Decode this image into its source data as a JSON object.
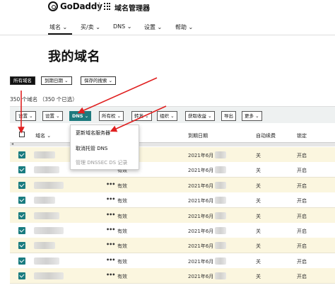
{
  "header": {
    "logo_text": "GoDaddy",
    "app_title": "域名管理器"
  },
  "nav": {
    "items": [
      "域名 ⌄",
      "买/卖 ⌄",
      "DNS ⌄",
      "设置 ⌄",
      "帮助 ⌄"
    ]
  },
  "page_title": "我的域名",
  "filters": [
    "所有域名",
    "到期日期 ⌄",
    "保存的搜索 ⌄"
  ],
  "count_text": "350 个域名 （350 个已选）",
  "toolbar": [
    "设置 ⌄",
    "设置 ⌄",
    "DNS ⌄",
    "所有权 ⌄",
    "转发 ⌄",
    "组织 ⌄",
    "获取收益 ⌄",
    "导出",
    "更多 ⌄"
  ],
  "table": {
    "columns": [
      "域名 ⌄",
      "状态",
      "到期日期",
      "自动续费",
      "锁定"
    ],
    "rows": [
      {
        "status": "有效",
        "expiry": "2021年6月",
        "auto_renew": "关",
        "lock": "开启"
      },
      {
        "status": "有效",
        "expiry": "2021年6月",
        "auto_renew": "关",
        "lock": "开启"
      },
      {
        "status": "有效",
        "expiry": "2021年6月",
        "auto_renew": "关",
        "lock": "开启"
      },
      {
        "status": "有效",
        "expiry": "2021年6月",
        "auto_renew": "关",
        "lock": "开启"
      },
      {
        "status": "有效",
        "expiry": "2021年6月",
        "auto_renew": "关",
        "lock": "开启"
      },
      {
        "status": "有效",
        "expiry": "2021年6月",
        "auto_renew": "关",
        "lock": "开启"
      },
      {
        "status": "有效",
        "expiry": "2021年6月",
        "auto_renew": "关",
        "lock": "开启"
      },
      {
        "status": "有效",
        "expiry": "2021年6月",
        "auto_renew": "关",
        "lock": "开启"
      },
      {
        "status": "有效",
        "expiry": "2021年6月",
        "auto_renew": "关",
        "lock": "开启"
      }
    ]
  },
  "dns_dropdown": {
    "items": [
      "更新域名服务器",
      "取消托管 DNS",
      "管理 DNSSEC DS 记录"
    ]
  },
  "colors": {
    "accent": "#1e7a7e",
    "row_highlight": "#fbf6df",
    "annotation_arrow": "#e02020"
  }
}
